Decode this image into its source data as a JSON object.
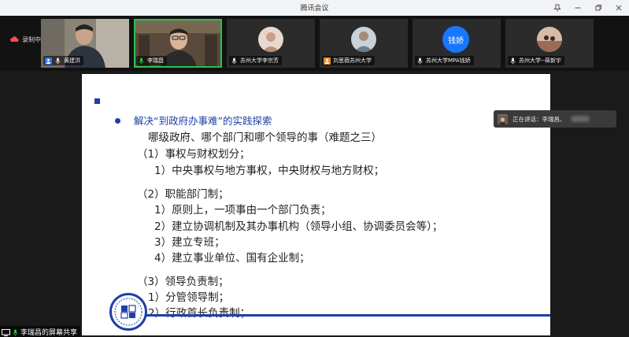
{
  "window": {
    "title": "腾讯会议"
  },
  "toolbar": {
    "record_label": "录制中"
  },
  "participants": [
    {
      "name": "黄建洪",
      "badge": "user",
      "video": "photo"
    },
    {
      "name": "李瑞昌",
      "badge": "mic",
      "video": "photo",
      "active": true
    },
    {
      "name": "苏州大学李宗芳",
      "badge": "mic",
      "video": "avatar"
    },
    {
      "name": "刘思薇苏州大学",
      "badge": "host",
      "video": "avatar"
    },
    {
      "name": "苏州大学MPA钱娇",
      "badge": "mic",
      "video": "text-avatar",
      "avatar_text": "钱娇"
    },
    {
      "name": "苏州大学--蒋新宇",
      "badge": "mic",
      "video": "avatar"
    }
  ],
  "slide": {
    "heading": "解决“到政府办事难”的实践探索",
    "lines": [
      "哪级政府、哪个部门和哪个领导的事（难题之三）",
      "（1）事权与财权划分；",
      "1）中央事权与地方事权，中央财权与地方财权；",
      "（2）职能部门制；",
      "1）原则上，一项事由一个部门负责；",
      "2）建立协调机制及其办事机构（领导小组、协调委员会等）；",
      "3）建立专班；",
      "4）建立事业单位、国有企业制；",
      "（3）领导负责制；",
      "1）分管领导制；",
      "2）行政首长负责制；"
    ]
  },
  "speaking": {
    "label": "正在讲话：李瑞昌、"
  },
  "share": {
    "label": "李瑞昌的屏幕共享"
  },
  "colors": {
    "accent": "#1f3fa8",
    "active_border": "#27c24c",
    "text_avatar_bg": "#1777ff"
  }
}
